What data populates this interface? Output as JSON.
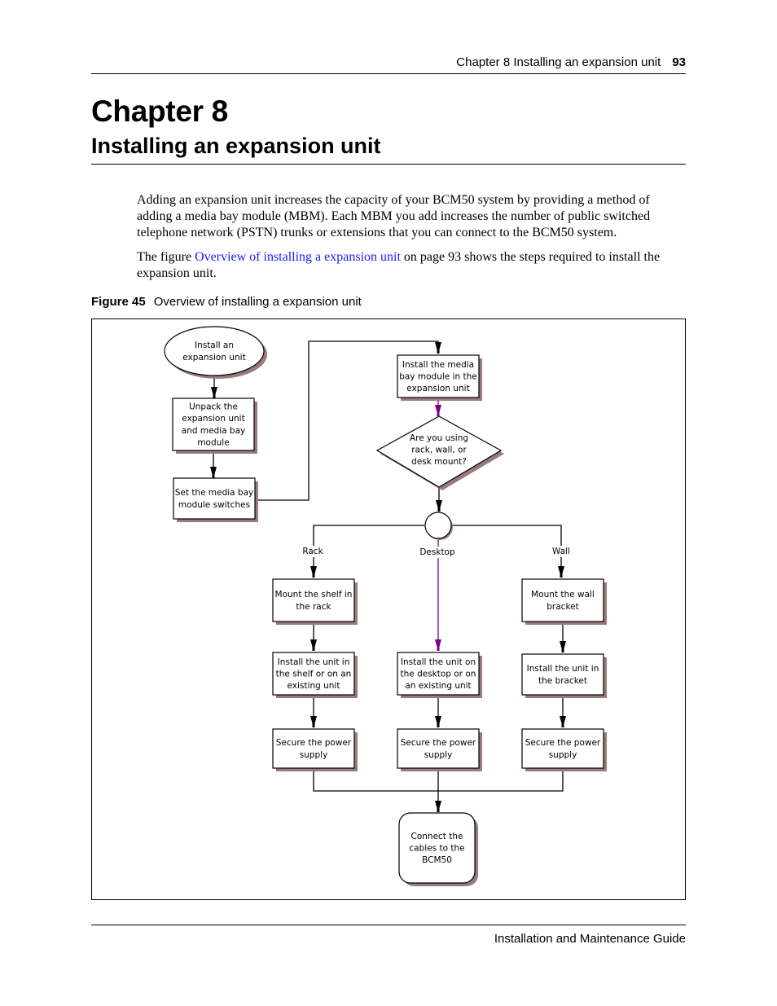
{
  "header": {
    "running_title": "Chapter 8  Installing an expansion unit",
    "page_number": "93"
  },
  "chapter": {
    "number_label": "Chapter 8",
    "title": "Installing an expansion unit"
  },
  "body": {
    "paragraph1": "Adding an expansion unit increases the capacity of your BCM50 system by providing a method of adding a media bay module (MBM). Each MBM you add increases the number of public switched telephone network (PSTN) trunks or extensions that you can connect to the BCM50 system.",
    "paragraph2_prefix": "The figure ",
    "paragraph2_link": "Overview of installing a expansion unit",
    "paragraph2_suffix": " on page 93 shows the steps required to install the expansion unit."
  },
  "figure": {
    "label": "Figure 45",
    "caption": "Overview of installing a expansion unit",
    "colors": {
      "highlight_path": "#800080",
      "shadow": "#9a7b7b",
      "line": "#000000"
    },
    "nodes": {
      "start": [
        "Install an",
        "expansion unit"
      ],
      "unpack": [
        "Unpack the",
        "expansion unit",
        "and media bay",
        "module"
      ],
      "switches": [
        "Set the media bay",
        "module switches"
      ],
      "install_mbm": [
        "Install the media",
        "bay module in the",
        "expansion unit"
      ],
      "decision": [
        "Are you using",
        "rack, wall, or",
        "desk mount?"
      ],
      "rack_mount": [
        "Mount the shelf in",
        "the rack"
      ],
      "rack_install": [
        "Install the unit in",
        "the shelf or on an",
        "existing unit"
      ],
      "rack_power": [
        "Secure the power",
        "supply"
      ],
      "desk_install": [
        "Install the unit on",
        "the desktop or on",
        "an existing unit"
      ],
      "desk_power": [
        "Secure the power",
        "supply"
      ],
      "wall_mount": [
        "Mount the wall",
        "bracket"
      ],
      "wall_install": [
        "Install the unit in",
        "the bracket"
      ],
      "wall_power": [
        "Secure the power",
        "supply"
      ],
      "end": [
        "Connect the",
        "cables to the",
        "BCM50"
      ]
    },
    "branch_labels": {
      "rack": "Rack",
      "desktop": "Desktop",
      "wall": "Wall"
    }
  },
  "footer": {
    "guide_title": "Installation and Maintenance Guide"
  }
}
